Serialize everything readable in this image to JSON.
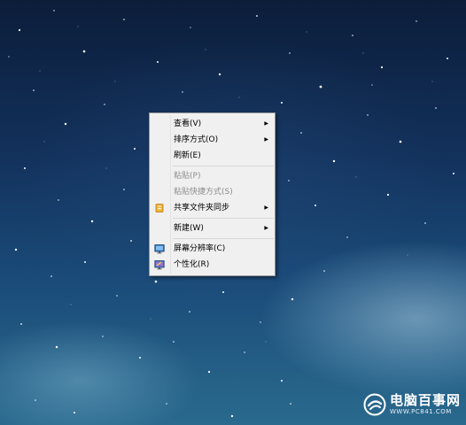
{
  "context_menu": {
    "items": [
      {
        "label": "查看(V)",
        "submenu": true,
        "enabled": true
      },
      {
        "label": "排序方式(O)",
        "submenu": true,
        "enabled": true
      },
      {
        "label": "刷新(E)",
        "submenu": false,
        "enabled": true
      },
      {
        "label": "粘贴(P)",
        "submenu": false,
        "enabled": false
      },
      {
        "label": "粘贴快捷方式(S)",
        "submenu": false,
        "enabled": false
      },
      {
        "label": "共享文件夹同步",
        "submenu": true,
        "enabled": true,
        "icon": "sync-folder-icon"
      },
      {
        "label": "新建(W)",
        "submenu": true,
        "enabled": true
      },
      {
        "label": "屏幕分辨率(C)",
        "submenu": false,
        "enabled": true,
        "icon": "screen-resolution-icon"
      },
      {
        "label": "个性化(R)",
        "submenu": false,
        "enabled": true,
        "icon": "personalize-icon"
      }
    ]
  },
  "watermark": {
    "title": "电脑百事网",
    "url": "WWW.PC841.COM"
  },
  "colors": {
    "menu_background": "#f0f0f0",
    "menu_border": "#979797",
    "disabled_text": "#8d8d8d",
    "desktop_sky": "#12305a"
  }
}
